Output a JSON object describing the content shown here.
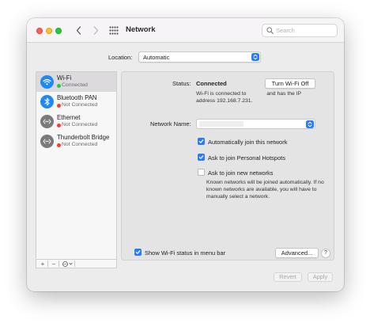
{
  "window": {
    "title": "Network"
  },
  "search": {
    "placeholder": "Search"
  },
  "location": {
    "label": "Location:",
    "value": "Automatic"
  },
  "sidebar": {
    "items": [
      {
        "name": "Wi-Fi",
        "status": "Connected",
        "status_color": "#28c840",
        "icon": "wifi-icon",
        "icon_bg": "#1e88f5",
        "selected": true
      },
      {
        "name": "Bluetooth PAN",
        "status": "Not Connected",
        "status_color": "#ff3b30",
        "icon": "bluetooth-icon",
        "icon_bg": "#1e88f5",
        "selected": false
      },
      {
        "name": "Ethernet",
        "status": "Not Connected",
        "status_color": "#ff3b30",
        "icon": "ethernet-icon",
        "icon_bg": "#7a7a7a",
        "selected": false
      },
      {
        "name": "Thunderbolt Bridge",
        "status": "Not Connected",
        "status_color": "#ff3b30",
        "icon": "thunderbolt-bridge-icon",
        "icon_bg": "#7a7a7a",
        "selected": false
      }
    ],
    "tools": {
      "add": "+",
      "remove": "−"
    }
  },
  "detail": {
    "status_label": "Status:",
    "status_value": "Connected",
    "turn_off_button": "Turn Wi-Fi Off",
    "status_desc_part1": "Wi-Fi is connected to",
    "status_desc_part2": "and has the IP",
    "status_desc_line2": "address 192.168.7.231.",
    "network_name_label": "Network Name:",
    "checkboxes": [
      {
        "label": "Automatically join this network",
        "checked": true
      },
      {
        "label": "Ask to join Personal Hotspots",
        "checked": true
      },
      {
        "label": "Ask to join new networks",
        "checked": false
      }
    ],
    "new_networks_desc": "Known networks will be joined automatically. If no known networks are available, you will have to manually select a network."
  },
  "footer": {
    "show_status_label": "Show Wi-Fi status in menu bar",
    "show_status_checked": true,
    "advanced_button": "Advanced...",
    "help_button": "?",
    "revert_button": "Revert",
    "apply_button": "Apply"
  },
  "colors": {
    "accent": "#2a7cf3"
  }
}
